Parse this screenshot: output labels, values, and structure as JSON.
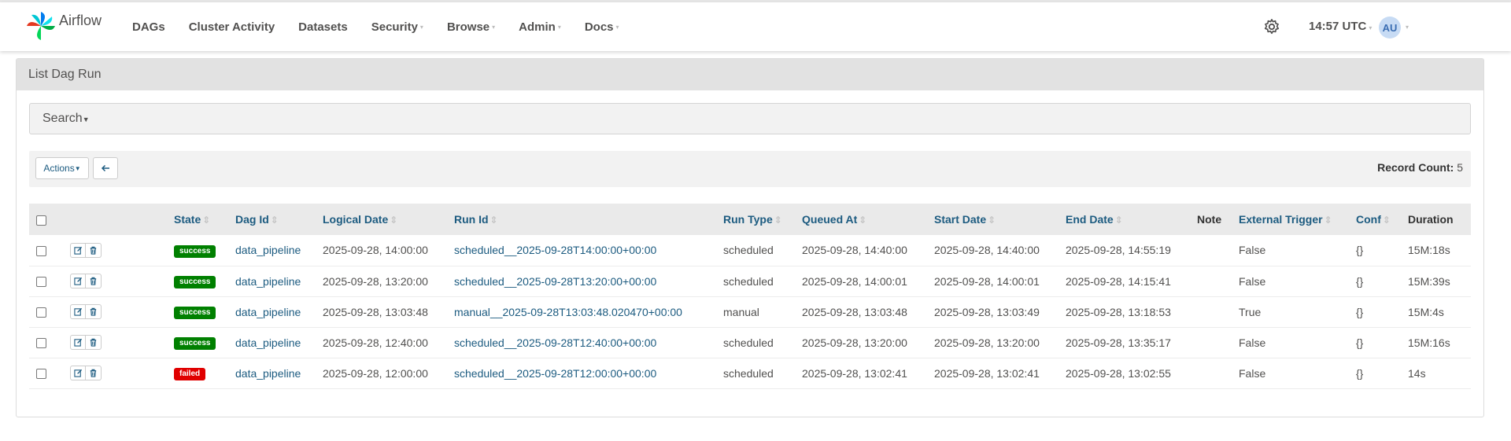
{
  "nav": {
    "brand": "Airflow",
    "items": [
      {
        "label": "DAGs",
        "dropdown": false
      },
      {
        "label": "Cluster Activity",
        "dropdown": false
      },
      {
        "label": "Datasets",
        "dropdown": false
      },
      {
        "label": "Security",
        "dropdown": true
      },
      {
        "label": "Browse",
        "dropdown": true
      },
      {
        "label": "Admin",
        "dropdown": true
      },
      {
        "label": "Docs",
        "dropdown": true
      }
    ],
    "time": "14:57 UTC",
    "avatar": "AU"
  },
  "panel": {
    "title": "List Dag Run",
    "search_label": "Search",
    "actions_label": "Actions",
    "record_count_label": "Record Count:",
    "record_count": "5"
  },
  "table": {
    "columns": [
      "State",
      "Dag Id",
      "Logical Date",
      "Run Id",
      "Run Type",
      "Queued At",
      "Start Date",
      "End Date",
      "Note",
      "External Trigger",
      "Conf",
      "Duration"
    ],
    "rows": [
      {
        "state": "success",
        "dag_id": "data_pipeline",
        "logical_date": "2025-09-28, 14:00:00",
        "run_id": "scheduled__2025-09-28T14:00:00+00:00",
        "run_type": "scheduled",
        "queued_at": "2025-09-28, 14:40:00",
        "start_date": "2025-09-28, 14:40:00",
        "end_date": "2025-09-28, 14:55:19",
        "note": "",
        "external_trigger": "False",
        "conf": "{}",
        "duration": "15M:18s"
      },
      {
        "state": "success",
        "dag_id": "data_pipeline",
        "logical_date": "2025-09-28, 13:20:00",
        "run_id": "scheduled__2025-09-28T13:20:00+00:00",
        "run_type": "scheduled",
        "queued_at": "2025-09-28, 14:00:01",
        "start_date": "2025-09-28, 14:00:01",
        "end_date": "2025-09-28, 14:15:41",
        "note": "",
        "external_trigger": "False",
        "conf": "{}",
        "duration": "15M:39s"
      },
      {
        "state": "success",
        "dag_id": "data_pipeline",
        "logical_date": "2025-09-28, 13:03:48",
        "run_id": "manual__2025-09-28T13:03:48.020470+00:00",
        "run_type": "manual",
        "queued_at": "2025-09-28, 13:03:48",
        "start_date": "2025-09-28, 13:03:49",
        "end_date": "2025-09-28, 13:18:53",
        "note": "",
        "external_trigger": "True",
        "conf": "{}",
        "duration": "15M:4s"
      },
      {
        "state": "success",
        "dag_id": "data_pipeline",
        "logical_date": "2025-09-28, 12:40:00",
        "run_id": "scheduled__2025-09-28T12:40:00+00:00",
        "run_type": "scheduled",
        "queued_at": "2025-09-28, 13:20:00",
        "start_date": "2025-09-28, 13:20:00",
        "end_date": "2025-09-28, 13:35:17",
        "note": "",
        "external_trigger": "False",
        "conf": "{}",
        "duration": "15M:16s"
      },
      {
        "state": "failed",
        "dag_id": "data_pipeline",
        "logical_date": "2025-09-28, 12:00:00",
        "run_id": "scheduled__2025-09-28T12:00:00+00:00",
        "run_type": "scheduled",
        "queued_at": "2025-09-28, 13:02:41",
        "start_date": "2025-09-28, 13:02:41",
        "end_date": "2025-09-28, 13:02:55",
        "note": "",
        "external_trigger": "False",
        "conf": "{}",
        "duration": "14s"
      }
    ]
  },
  "colors": {
    "link": "#1c5b80",
    "success": "#008000",
    "failed": "#e00000",
    "header_bg": "#e2e2e2"
  },
  "icons": {
    "settings": "gear-icon",
    "back": "arrow-left-icon",
    "edit": "edit-icon",
    "delete": "trash-icon"
  }
}
